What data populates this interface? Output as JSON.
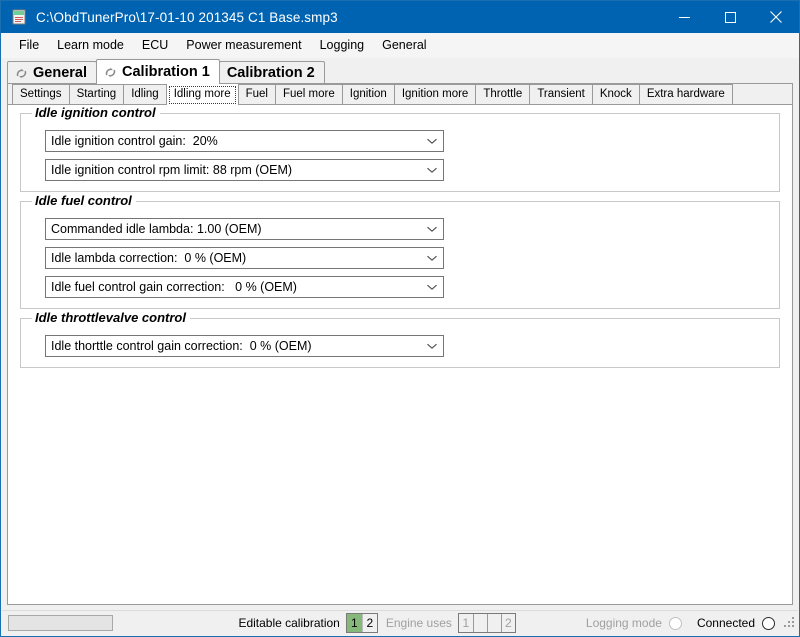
{
  "window": {
    "title": "C:\\ObdTunerPro\\17-01-10 201345 C1 Base.smp3",
    "icon": "document-icon",
    "accent_color": "#0063b1",
    "minimize_label": "Minimize",
    "maximize_label": "Maximize",
    "close_label": "Close"
  },
  "menubar": {
    "items": [
      {
        "label": "File"
      },
      {
        "label": "Learn mode"
      },
      {
        "label": "ECU"
      },
      {
        "label": "Power measurement"
      },
      {
        "label": "Logging"
      },
      {
        "label": "General"
      }
    ]
  },
  "main_tabs": {
    "items": [
      {
        "label": "General",
        "icon": "recycle-icon",
        "selected": false
      },
      {
        "label": "Calibration 1",
        "icon": "recycle-icon",
        "selected": true
      },
      {
        "label": "Calibration 2",
        "icon": null,
        "selected": false
      }
    ]
  },
  "sub_tabs": {
    "items": [
      {
        "label": "Settings",
        "selected": false
      },
      {
        "label": "Starting",
        "selected": false
      },
      {
        "label": "Idling",
        "selected": false
      },
      {
        "label": "Idling more",
        "selected": true
      },
      {
        "label": "Fuel",
        "selected": false
      },
      {
        "label": "Fuel more",
        "selected": false
      },
      {
        "label": "Ignition",
        "selected": false
      },
      {
        "label": "Ignition more",
        "selected": false
      },
      {
        "label": "Throttle",
        "selected": false
      },
      {
        "label": "Transient",
        "selected": false
      },
      {
        "label": "Knock",
        "selected": false
      },
      {
        "label": "Extra hardware",
        "selected": false
      }
    ]
  },
  "groups": [
    {
      "title": "Idle ignition control",
      "combos": [
        {
          "label": "Idle ignition control gain:",
          "value": "20%"
        },
        {
          "label": "Idle ignition control rpm limit:",
          "value": "88 rpm (OEM)"
        }
      ]
    },
    {
      "title": "Idle fuel control",
      "combos": [
        {
          "label": "Commanded idle lambda:",
          "value": "1.00 (OEM)"
        },
        {
          "label": "Idle lambda correction:",
          "value": "0 % (OEM)"
        },
        {
          "label": "Idle fuel control gain correction:",
          "value": "0 % (OEM)"
        }
      ]
    },
    {
      "title": "Idle throttlevalve control",
      "combos": [
        {
          "label": "Idle thorttle control gain correction:",
          "value": "0 % (OEM)"
        }
      ]
    }
  ],
  "statusbar": {
    "progress_value": "",
    "editable_calibration_label": "Editable calibration",
    "calibration_cells": [
      {
        "text": "1",
        "active": true
      },
      {
        "text": "2",
        "active": false
      }
    ],
    "engine_uses_label": "Engine uses",
    "engine_uses_cells": [
      {
        "text": "1"
      },
      {
        "text": ""
      },
      {
        "text": ""
      },
      {
        "text": "2"
      }
    ],
    "logging_mode_label": "Logging mode",
    "logging_mode_state": "off",
    "connected_label": "Connected",
    "connected_state": "off",
    "resize-grip": "resize-grip-icon"
  }
}
